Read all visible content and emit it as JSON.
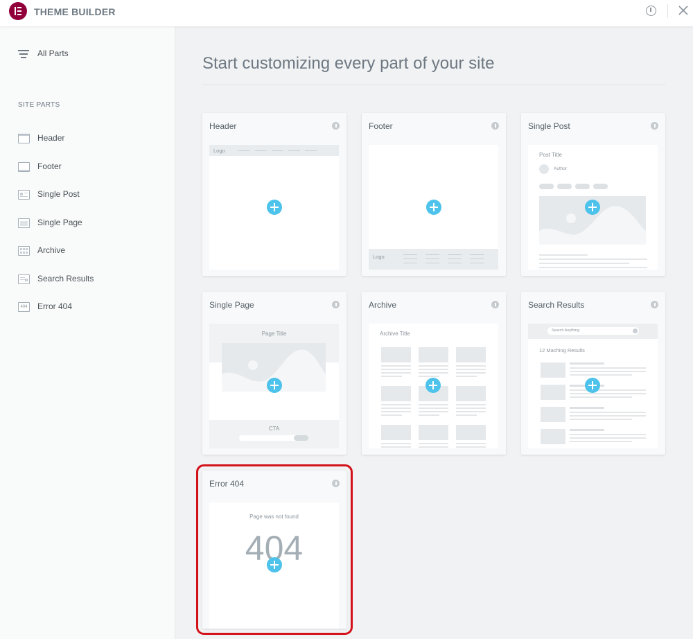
{
  "app": {
    "title": "THEME BUILDER",
    "logo_icon": "elementor-logo-icon",
    "accent": "#92003b"
  },
  "header_actions": {
    "info_icon": "info-circle-icon",
    "close_icon": "close-icon"
  },
  "sidebar": {
    "all_parts_label": "All Parts",
    "section_label": "SITE PARTS",
    "items": [
      {
        "label": "Header",
        "icon": "header-icon"
      },
      {
        "label": "Footer",
        "icon": "footer-icon"
      },
      {
        "label": "Single Post",
        "icon": "single-post-icon"
      },
      {
        "label": "Single Page",
        "icon": "single-page-icon"
      },
      {
        "label": "Archive",
        "icon": "archive-icon"
      },
      {
        "label": "Search Results",
        "icon": "search-results-icon"
      },
      {
        "label": "Error 404",
        "icon": "error-404-icon"
      }
    ]
  },
  "main": {
    "title": "Start customizing every part of your site",
    "highlight_color": "#d3121b",
    "plus_color": "#4dc2ea",
    "cards": [
      {
        "title": "Header",
        "preview": {
          "logo": "Logo"
        }
      },
      {
        "title": "Footer",
        "preview": {
          "logo": "Logo"
        }
      },
      {
        "title": "Single Post",
        "preview": {
          "post_title": "Post Title",
          "author": "Author"
        }
      },
      {
        "title": "Single Page",
        "preview": {
          "page_title": "Page Title",
          "cta": "CTA"
        }
      },
      {
        "title": "Archive",
        "preview": {
          "archive_title": "Archive Title"
        }
      },
      {
        "title": "Search Results",
        "preview": {
          "search_placeholder": "Search Anything",
          "results_text": "12 Maching Results"
        }
      },
      {
        "title": "Error 404",
        "selected": true,
        "preview": {
          "message": "Page was not found",
          "code": "404"
        }
      }
    ]
  }
}
